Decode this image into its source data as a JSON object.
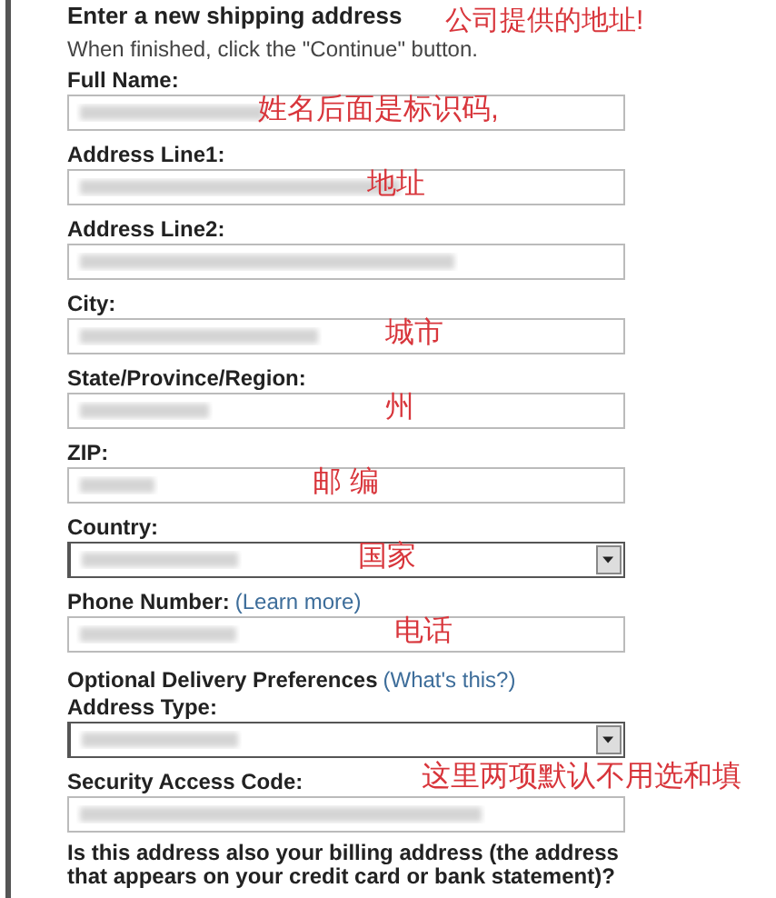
{
  "heading": "Enter a new shipping address",
  "top_note": "公司提供的地址!",
  "instructions": "When finished, click the \"Continue\" button.",
  "fields": [
    {
      "kind": "text",
      "label": "Full Name:",
      "note": "姓名后面是标识码,"
    },
    {
      "kind": "text",
      "label": "Address Line1:",
      "note": "地址"
    },
    {
      "kind": "text",
      "label": "Address Line2:"
    },
    {
      "kind": "text",
      "label": "City:",
      "note": "城市"
    },
    {
      "kind": "text",
      "label": "State/Province/Region:",
      "note": "州"
    },
    {
      "kind": "text",
      "label": "ZIP:",
      "note": "邮 编"
    },
    {
      "kind": "select",
      "label": "Country:",
      "note": "国家"
    },
    {
      "kind": "text",
      "label": "Phone Number:",
      "link": "(Learn more)",
      "note": "电话"
    },
    {
      "kind": "section",
      "label": "Optional Delivery Preferences",
      "link": "(What's this?)"
    },
    {
      "kind": "select",
      "label": "Address Type:",
      "note": "这里两项默认不用选和填"
    },
    {
      "kind": "text",
      "label": "Security Access Code:"
    }
  ],
  "billing_question": "Is this address also your billing address (the address that appears on your credit card or bank statement)?"
}
